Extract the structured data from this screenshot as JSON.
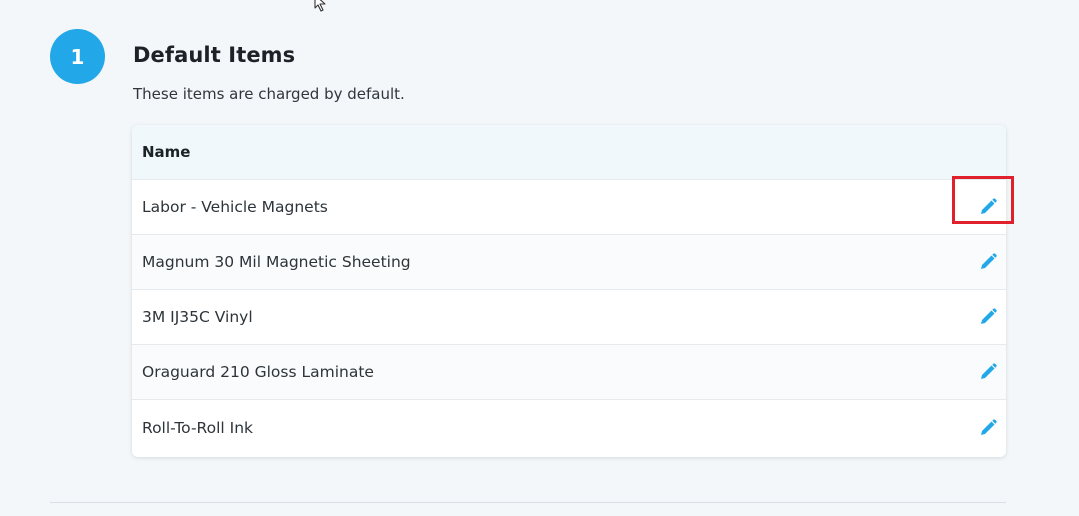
{
  "step": {
    "number": "1",
    "title": "Default Items",
    "description": "These items are charged by default."
  },
  "table": {
    "header": "Name",
    "rows": [
      {
        "name": "Labor - Vehicle Magnets",
        "highlighted": true
      },
      {
        "name": "Magnum 30 Mil Magnetic Sheeting",
        "highlighted": false
      },
      {
        "name": "3M IJ35C Vinyl",
        "highlighted": false
      },
      {
        "name": "Oraguard 210 Gloss Laminate",
        "highlighted": false
      },
      {
        "name": "Roll-To-Roll Ink",
        "highlighted": false
      }
    ]
  },
  "icons": {
    "edit": "pencil-icon",
    "cursor": "mouse-pointer-icon"
  },
  "colors": {
    "accent": "#22a7e8",
    "highlight": "#e0202b",
    "header_bg": "#f0f8fc",
    "page_bg": "#f3f7f9"
  }
}
